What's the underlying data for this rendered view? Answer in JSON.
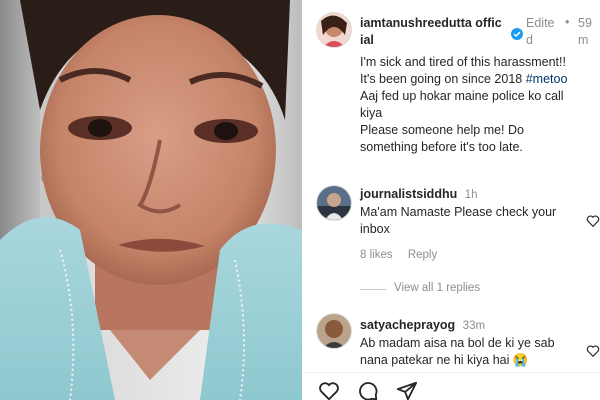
{
  "post": {
    "username_line1": "iamtanushreedutta offic",
    "username_line2": "ial",
    "edited_line1": "Edite",
    "edited_line2": "d",
    "dot": "•",
    "time_line1": "59",
    "time_line2": "m",
    "caption_lines": [
      "I'm sick and tired of this harassment!!",
      "It's been going on since 2018 ",
      "Aaj fed up hokar maine police ko call",
      "kiya",
      "Please someone help me! Do",
      "something before it's too late."
    ],
    "hashtag": "#metoo"
  },
  "comments": [
    {
      "username": "journalistsiddhu",
      "time": "1h",
      "text_lines": [
        "Ma'am Namaste Please check your",
        "inbox"
      ],
      "likes": "8 likes",
      "reply_label": "Reply",
      "view_replies": "View all 1 replies"
    },
    {
      "username": "satyacheprayog",
      "time": "33m",
      "text_lines": [
        "Ab madam aisa na bol de ki ye sab",
        "nana patekar ne hi kiya hai 😭"
      ]
    }
  ],
  "icons": {
    "verified": "verified-badge-icon",
    "like": "heart-icon",
    "comment": "comment-icon",
    "share": "share-icon"
  },
  "colors": {
    "hashtag": "#00376b",
    "verified": "#1d9bf0",
    "muted": "#8e8e8e"
  }
}
